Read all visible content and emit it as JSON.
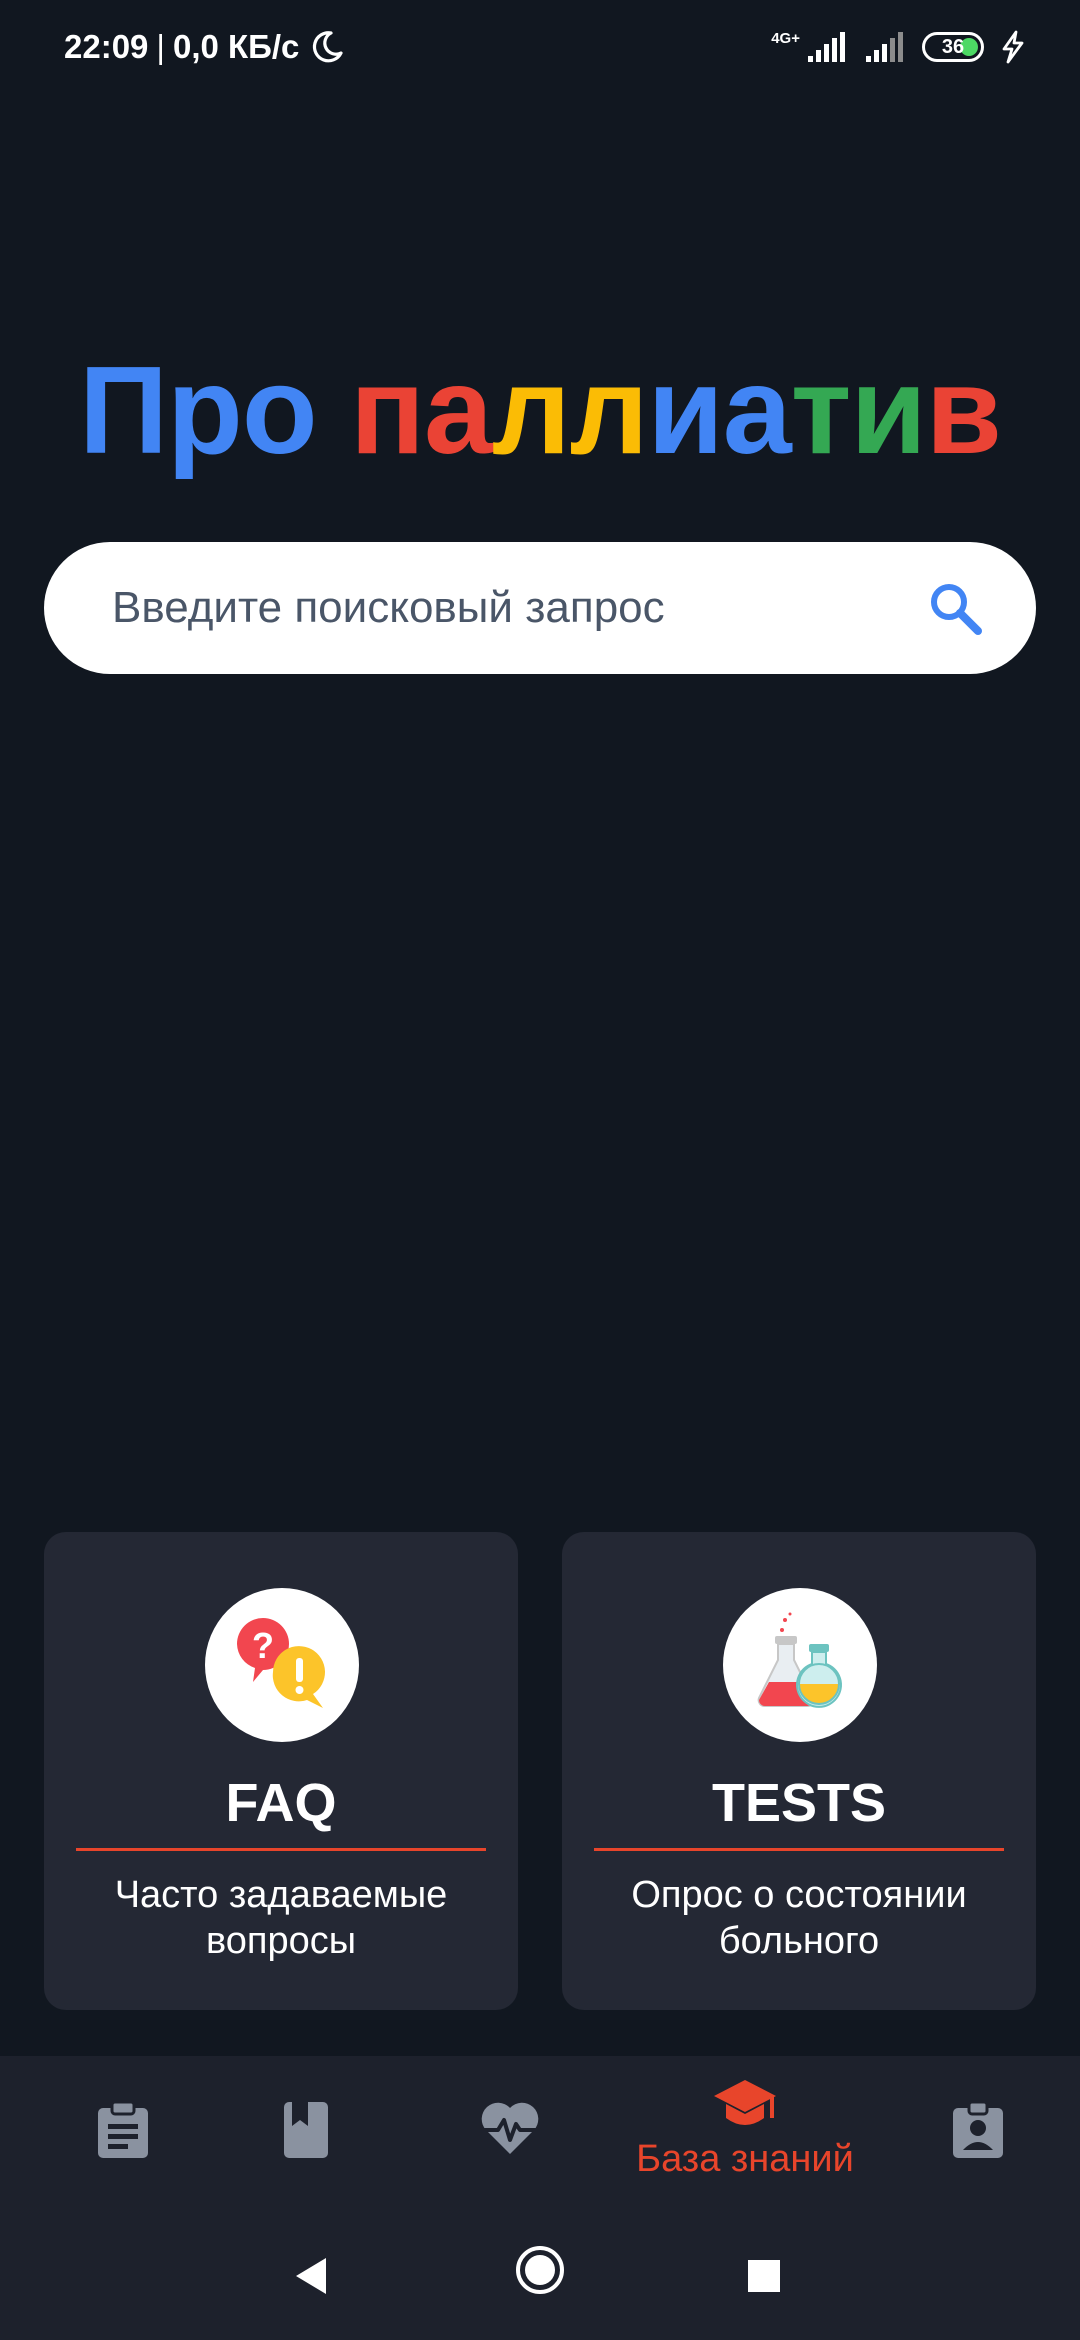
{
  "status_bar": {
    "time": "22:09",
    "separator": "|",
    "speed": "0,0 КБ/с",
    "network_type": "4G+",
    "battery_level": "36",
    "icons": [
      "moon-icon",
      "signal-icon",
      "signal-icon",
      "battery-icon",
      "charging-icon"
    ]
  },
  "app": {
    "title_words": [
      "Про",
      "паллиатив"
    ],
    "title_letters": [
      {
        "char": "Про",
        "color": "#4285f4"
      },
      {
        "char": " ",
        "color": "#ffffff"
      },
      {
        "char": "п",
        "color": "#ea4335"
      },
      {
        "char": "а",
        "color": "#ea4335"
      },
      {
        "char": "л",
        "color": "#fbbc05"
      },
      {
        "char": "л",
        "color": "#fbbc05"
      },
      {
        "char": "и",
        "color": "#4285f4"
      },
      {
        "char": "а",
        "color": "#4285f4"
      },
      {
        "char": "т",
        "color": "#34a853"
      },
      {
        "char": "и",
        "color": "#34a853"
      },
      {
        "char": "в",
        "color": "#ea4335"
      }
    ]
  },
  "search": {
    "placeholder": "Введите поисковый запрос",
    "icon": "search-icon"
  },
  "cards": [
    {
      "title": "FAQ",
      "subtitle": "Часто задаваемые вопросы",
      "icon": "faq-icon"
    },
    {
      "title": "TESTS",
      "subtitle": "Опрос о состоянии больного",
      "icon": "flask-icon"
    }
  ],
  "bottom_nav": {
    "items": [
      {
        "icon": "clipboard-icon",
        "label": "",
        "active": false
      },
      {
        "icon": "book-icon",
        "label": "",
        "active": false
      },
      {
        "icon": "heart-pulse-icon",
        "label": "",
        "active": false
      },
      {
        "icon": "graduation-cap-icon",
        "label": "База знаний",
        "active": true
      },
      {
        "icon": "contact-badge-icon",
        "label": "",
        "active": false
      }
    ]
  },
  "colors": {
    "background": "#111720",
    "card": "#242834",
    "accent": "#e8452b",
    "nav_inactive": "#8a92a0",
    "search_icon": "#4285f4"
  }
}
